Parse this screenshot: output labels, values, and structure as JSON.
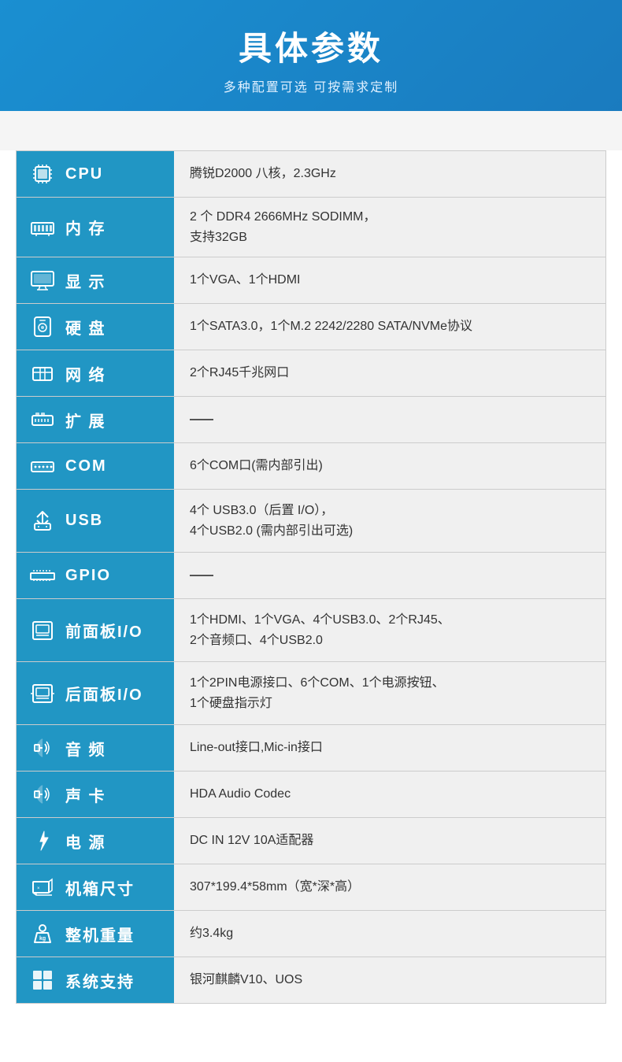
{
  "header": {
    "title": "具体参数",
    "subtitle": "多种配置可选 可按需求定制"
  },
  "specs": [
    {
      "id": "cpu",
      "label": "CPU",
      "value": "腾锐D2000 八核，2.3GHz",
      "multiline": false
    },
    {
      "id": "memory",
      "label": "内 存",
      "value": "2 个 DDR4 2666MHz SODIMM，\n支持32GB",
      "multiline": true
    },
    {
      "id": "display",
      "label": "显 示",
      "value": "1个VGA、1个HDMI",
      "multiline": false
    },
    {
      "id": "storage",
      "label": "硬 盘",
      "value": "1个SATA3.0，1个M.2 2242/2280 SATA/NVMe协议",
      "multiline": false
    },
    {
      "id": "network",
      "label": "网 络",
      "value": "2个RJ45千兆网口",
      "multiline": false
    },
    {
      "id": "expand",
      "label": "扩 展",
      "value": "——",
      "multiline": false,
      "dash": true
    },
    {
      "id": "com",
      "label": "COM",
      "value": "6个COM口(需内部引出)",
      "multiline": false
    },
    {
      "id": "usb",
      "label": "USB",
      "value": "4个 USB3.0（后置 I/O），\n4个USB2.0 (需内部引出可选)",
      "multiline": true
    },
    {
      "id": "gpio",
      "label": "GPIO",
      "value": "——",
      "multiline": false,
      "dash": true
    },
    {
      "id": "front-panel",
      "label": "前面板I/O",
      "value": "1个HDMI、1个VGA、4个USB3.0、2个RJ45、\n2个音频口、4个USB2.0",
      "multiline": true
    },
    {
      "id": "rear-panel",
      "label": "后面板I/O",
      "value": "1个2PIN电源接口、6个COM、1个电源按钮、\n1个硬盘指示灯",
      "multiline": true
    },
    {
      "id": "audio-port",
      "label": "音 频",
      "value": "Line-out接口,Mic-in接口",
      "multiline": false
    },
    {
      "id": "sound-card",
      "label": "声 卡",
      "value": "HDA Audio Codec",
      "multiline": false
    },
    {
      "id": "power",
      "label": "电 源",
      "value": "DC IN 12V 10A适配器",
      "multiline": false
    },
    {
      "id": "dimensions",
      "label": "机箱尺寸",
      "value": "307*199.4*58mm（宽*深*高）",
      "multiline": false
    },
    {
      "id": "weight",
      "label": "整机重量",
      "value": "约3.4kg",
      "multiline": false
    },
    {
      "id": "os",
      "label": "系统支持",
      "value": "银河麒麟V10、UOS",
      "multiline": false
    }
  ]
}
